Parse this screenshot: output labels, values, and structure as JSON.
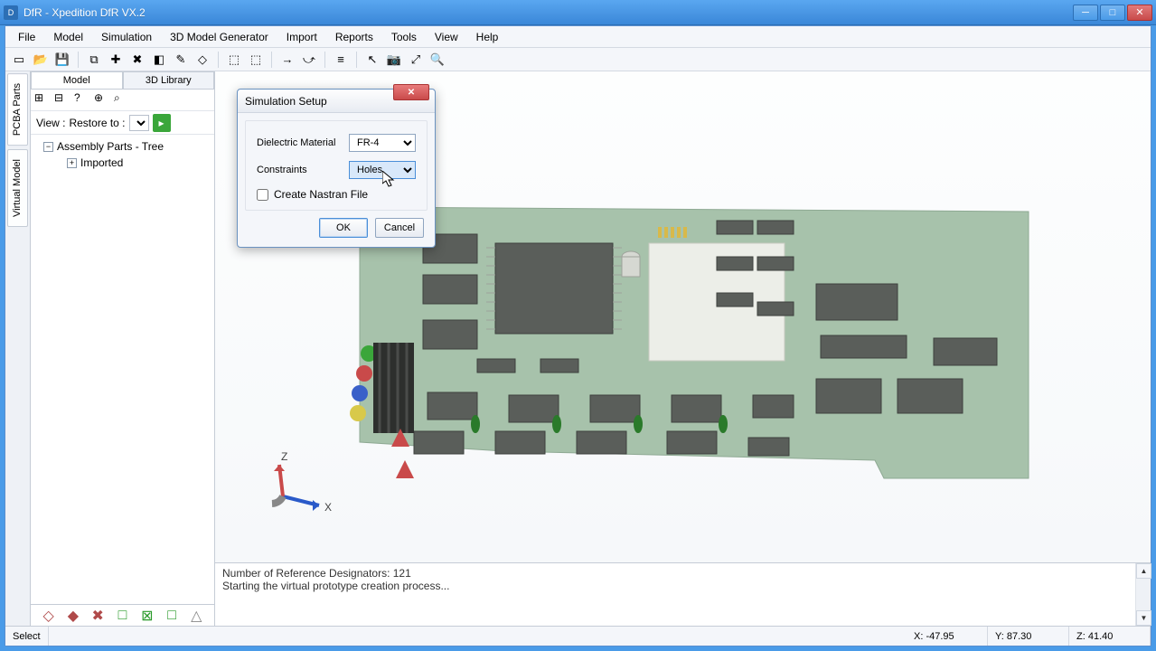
{
  "title": "DfR - Xpedition DfR VX.2",
  "menu": [
    "File",
    "Model",
    "Simulation",
    "3D Model Generator",
    "Import",
    "Reports",
    "Tools",
    "View",
    "Help"
  ],
  "toolbar_icons": [
    {
      "name": "new-icon",
      "glyph": "▭"
    },
    {
      "name": "open-icon",
      "glyph": "📂"
    },
    {
      "name": "save-icon",
      "glyph": "💾"
    },
    {
      "name": "sep"
    },
    {
      "name": "copy-icon",
      "glyph": "⧉"
    },
    {
      "name": "paste-icon",
      "glyph": "✚"
    },
    {
      "name": "cut-icon",
      "glyph": "✖"
    },
    {
      "name": "highlight-icon",
      "glyph": "◧"
    },
    {
      "name": "brush-icon",
      "glyph": "✎"
    },
    {
      "name": "layer-icon",
      "glyph": "◇"
    },
    {
      "name": "sep"
    },
    {
      "name": "cube-icon",
      "glyph": "⬚"
    },
    {
      "name": "cubes-icon",
      "glyph": "⬚"
    },
    {
      "name": "sep"
    },
    {
      "name": "export-icon",
      "glyph": "→"
    },
    {
      "name": "run-icon",
      "glyph": "⤻"
    },
    {
      "name": "sep"
    },
    {
      "name": "list-icon",
      "glyph": "≡"
    },
    {
      "name": "sep"
    },
    {
      "name": "pointer-icon",
      "glyph": "↖"
    },
    {
      "name": "camera-icon",
      "glyph": "📷"
    },
    {
      "name": "zoomfit-icon",
      "glyph": "⤢"
    },
    {
      "name": "zoom-icon",
      "glyph": "🔍"
    }
  ],
  "vertical_tabs": [
    "PCBA Parts",
    "Virtual Model"
  ],
  "side_tabs": [
    "Model",
    "3D Library"
  ],
  "side_toolbar": [
    {
      "name": "tree-icon",
      "glyph": "⊞"
    },
    {
      "name": "tree2-icon",
      "glyph": "⊟"
    },
    {
      "name": "help-icon",
      "glyph": "?"
    },
    {
      "name": "expand-icon",
      "glyph": "⊕"
    },
    {
      "name": "find-icon",
      "glyph": "⌕"
    }
  ],
  "view_label": "View :",
  "restore_label": "Restore to :",
  "tree": {
    "root": "Assembly Parts - Tree",
    "child": "Imported"
  },
  "shapes": [
    {
      "name": "diamond-empty",
      "color": "#b04a4a",
      "glyph": "◇"
    },
    {
      "name": "diamond-fill",
      "color": "#b04a4a",
      "glyph": "◆"
    },
    {
      "name": "diamond-x",
      "color": "#b04a4a",
      "glyph": "✖"
    },
    {
      "name": "square-empty",
      "color": "#2a9a2a",
      "glyph": "□"
    },
    {
      "name": "square-x",
      "color": "#2a9a2a",
      "glyph": "⊠"
    },
    {
      "name": "square-fill",
      "color": "#2a9a2a",
      "glyph": "□"
    },
    {
      "name": "triangle",
      "color": "#888",
      "glyph": "△"
    }
  ],
  "axes": {
    "x": "X",
    "z": "Z"
  },
  "console": {
    "line1": "Number of Reference Designators:  121",
    "line2": "Starting the virtual prototype creation process..."
  },
  "status": {
    "mode": "Select",
    "x": "X: -47.95",
    "y": "Y: 87.30",
    "z": "Z: 41.40"
  },
  "dialog": {
    "title": "Simulation Setup",
    "field1_label": "Dielectric Material",
    "field1_value": "FR-4",
    "field2_label": "Constraints",
    "field2_value": "Holes",
    "checkbox_label": "Create Nastran File",
    "ok": "OK",
    "cancel": "Cancel"
  }
}
